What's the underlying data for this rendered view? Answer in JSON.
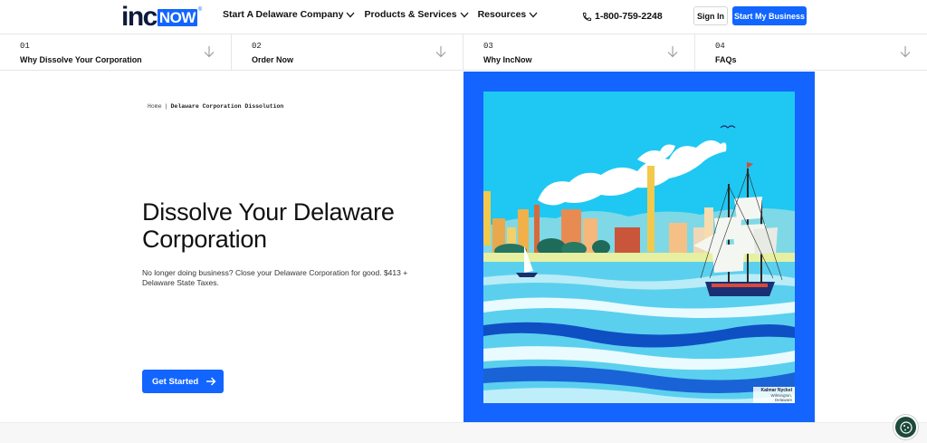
{
  "brand": {
    "logo_left": "inc",
    "logo_right": "NOW",
    "logo_mark": "®",
    "primary_color": "#1265ff"
  },
  "nav": {
    "items": [
      {
        "label": "Start A Delaware Company"
      },
      {
        "label": "Products & Services"
      },
      {
        "label": "Resources"
      }
    ],
    "phone": "1-800-759-2248",
    "sign_in": "Sign In",
    "cta": "Start My Business"
  },
  "tabs": [
    {
      "num": "01",
      "label": "Why Dissolve Your Corporation"
    },
    {
      "num": "02",
      "label": "Order Now"
    },
    {
      "num": "03",
      "label": "Why IncNow"
    },
    {
      "num": "04",
      "label": "FAQs"
    }
  ],
  "breadcrumb": {
    "home": "Home",
    "sep": "|",
    "current": "Delaware Corporation Dissolution"
  },
  "hero": {
    "title": "Dissolve Your Delaware Corporation",
    "subtitle": "No longer doing business? Close your Delaware Corporation for good. $413 + Delaware State Taxes.",
    "button": "Get Started"
  },
  "art": {
    "caption_title": "Kalmar Nyckel",
    "caption_place": "Wilmington, Delaware",
    "frame_color": "#1464ff",
    "sky_color": "#1ec8f2"
  }
}
